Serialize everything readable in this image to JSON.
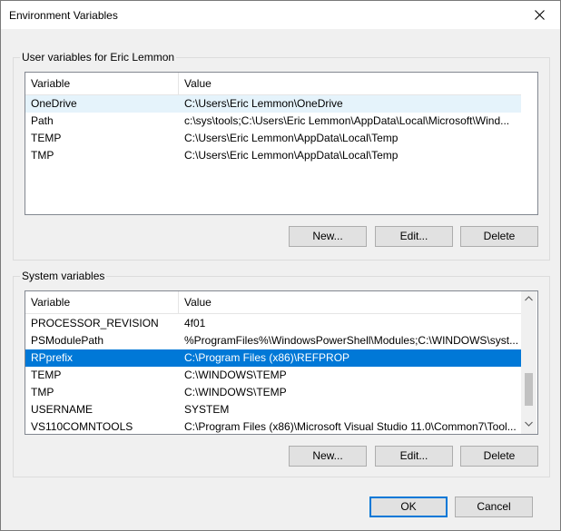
{
  "window": {
    "title": "Environment Variables"
  },
  "user_group": {
    "title": "User variables for Eric Lemmon",
    "columns": [
      "Variable",
      "Value"
    ],
    "rows": [
      {
        "variable": "OneDrive",
        "value": "C:\\Users\\Eric Lemmon\\OneDrive"
      },
      {
        "variable": "Path",
        "value": "c:\\sys\\tools;C:\\Users\\Eric Lemmon\\AppData\\Local\\Microsoft\\Wind..."
      },
      {
        "variable": "TEMP",
        "value": "C:\\Users\\Eric Lemmon\\AppData\\Local\\Temp"
      },
      {
        "variable": "TMP",
        "value": "C:\\Users\\Eric Lemmon\\AppData\\Local\\Temp"
      }
    ],
    "buttons": {
      "new": "New...",
      "edit": "Edit...",
      "delete": "Delete"
    }
  },
  "system_group": {
    "title": "System variables",
    "columns": [
      "Variable",
      "Value"
    ],
    "rows": [
      {
        "variable": "PROCESSOR_REVISION",
        "value": "4f01"
      },
      {
        "variable": "PSModulePath",
        "value": "%ProgramFiles%\\WindowsPowerShell\\Modules;C:\\WINDOWS\\syst..."
      },
      {
        "variable": "RPprefix",
        "value": "C:\\Program Files (x86)\\REFPROP"
      },
      {
        "variable": "TEMP",
        "value": "C:\\WINDOWS\\TEMP"
      },
      {
        "variable": "TMP",
        "value": "C:\\WINDOWS\\TEMP"
      },
      {
        "variable": "USERNAME",
        "value": "SYSTEM"
      },
      {
        "variable": "VS110COMNTOOLS",
        "value": "C:\\Program Files (x86)\\Microsoft Visual Studio 11.0\\Common7\\Tool..."
      }
    ],
    "selected_index": 2,
    "buttons": {
      "new": "New...",
      "edit": "Edit...",
      "delete": "Delete"
    }
  },
  "footer": {
    "ok": "OK",
    "cancel": "Cancel"
  },
  "icons": {
    "close": "close-icon",
    "scroll_up": "chevron-up-icon",
    "scroll_down": "chevron-down-icon"
  },
  "colors": {
    "selection": "#0078d7",
    "hover": "#e5f3fb",
    "default_button_border": "#0078d7"
  }
}
